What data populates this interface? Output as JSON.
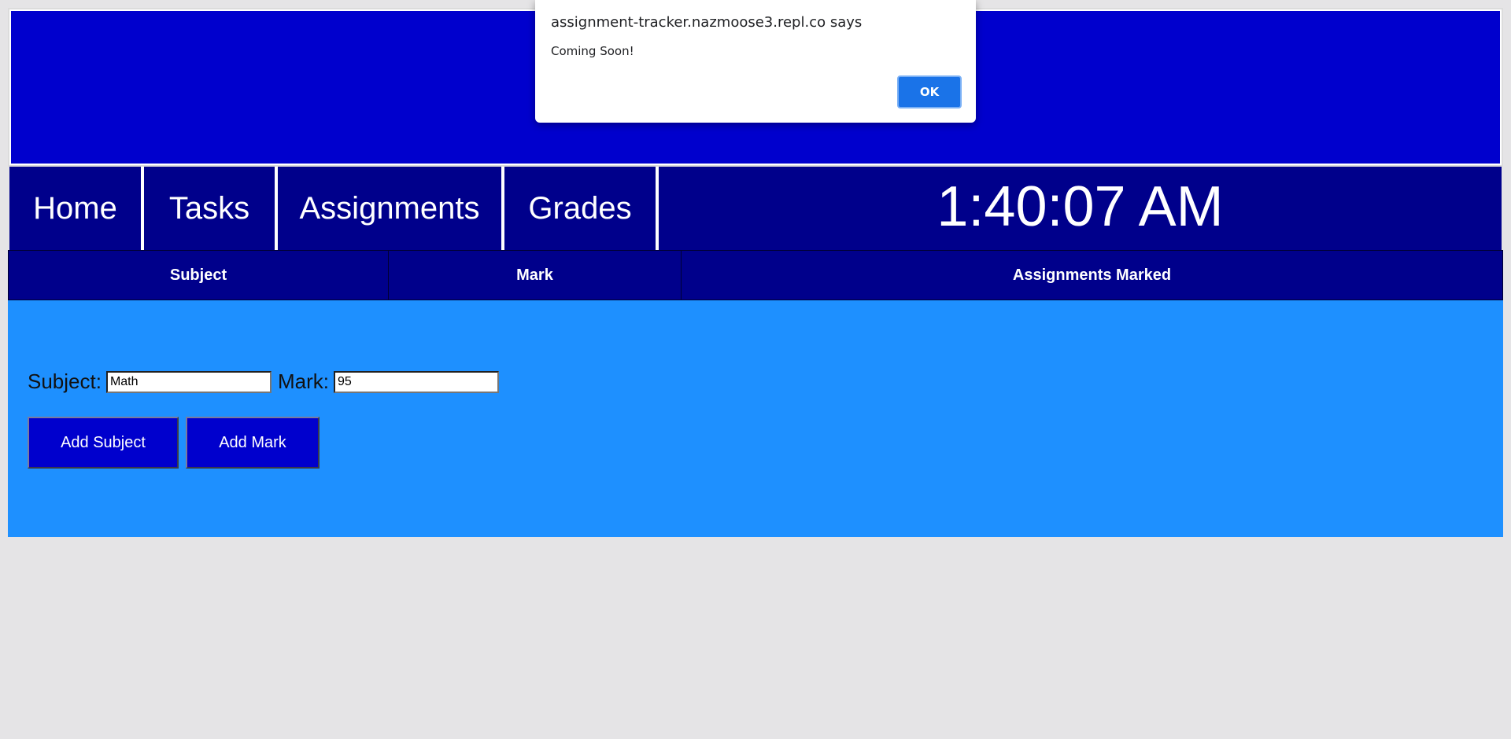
{
  "dialog": {
    "title": "assignment-tracker.nazmoose3.repl.co says",
    "message": "Coming Soon!",
    "ok_label": "OK"
  },
  "nav": {
    "home": "Home",
    "tasks": "Tasks",
    "assignments": "Assignments",
    "grades": "Grades"
  },
  "clock": {
    "time": "1:40:07 AM"
  },
  "table": {
    "headers": [
      "Subject",
      "Mark",
      "Assignments Marked"
    ]
  },
  "form": {
    "subject_label": "Subject:",
    "subject_value": "Math",
    "mark_label": "Mark:",
    "mark_value": "95",
    "add_subject_label": "Add Subject",
    "add_mark_label": "Add Mark"
  },
  "colors": {
    "banner": "#0000cd",
    "navbar": "#00008b",
    "form_panel": "#1e90ff",
    "page_background": "#e5e4e6",
    "dialog_button": "#1a73e8"
  }
}
